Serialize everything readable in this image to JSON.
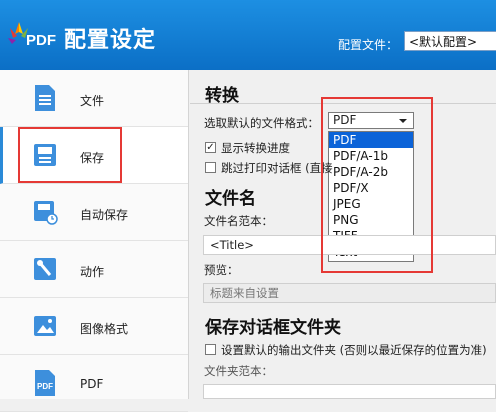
{
  "header": {
    "logo_text": "PDF",
    "title": "配置设定",
    "profile_label": "配置文件：",
    "profile_value": "<默认配置>"
  },
  "sidebar": {
    "items": [
      {
        "label": "文件",
        "icon": "document-icon"
      },
      {
        "label": "保存",
        "icon": "save-icon",
        "active": true
      },
      {
        "label": "自动保存",
        "icon": "auto-save-icon"
      },
      {
        "label": "动作",
        "icon": "action-icon"
      },
      {
        "label": "图像格式",
        "icon": "image-icon"
      },
      {
        "label": "PDF",
        "icon": "pdf-icon"
      }
    ]
  },
  "convert": {
    "title": "转换",
    "format_label": "选取默认的文件格式：",
    "format_value": "PDF",
    "format_options": [
      "PDF",
      "PDF/A-1b",
      "PDF/A-2b",
      "PDF/X",
      "JPEG",
      "PNG",
      "TIFF",
      "Text"
    ],
    "show_progress_label": "显示转换进度",
    "show_progress_checked": true,
    "skip_dialog_label": "跳过打印对话框 (直接",
    "skip_dialog_checked": false
  },
  "filename": {
    "title": "文件名",
    "template_label": "文件名范本：",
    "template_value": "<Title>",
    "preview_label": "预览：",
    "preview_value": "标题来自设置"
  },
  "save_dialog": {
    "title": "保存对话框文件夹",
    "default_output_label": "设置默认的输出文件夹 (否则以最近保存的位置为准)",
    "default_output_checked": false,
    "folder_template_label": "文件夹范本："
  },
  "colors": {
    "header_blue": "#1580d8",
    "highlight_red": "#e53935",
    "selection_blue": "#0b63d8"
  }
}
